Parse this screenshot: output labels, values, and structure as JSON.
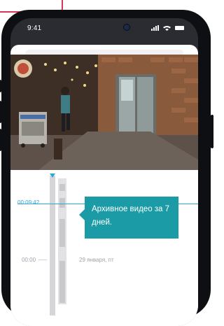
{
  "status_bar": {
    "time": "9:41"
  },
  "timeline": {
    "current_time": "00:09:42",
    "midnight_label": "00:00",
    "date_label": "29 января, пт"
  },
  "tooltip": {
    "text": "Архивное видео за 7 дней."
  },
  "colors": {
    "accent": "#2aa6d7",
    "tooltip": "#1a9ba6",
    "highlight": "#d9345a"
  }
}
